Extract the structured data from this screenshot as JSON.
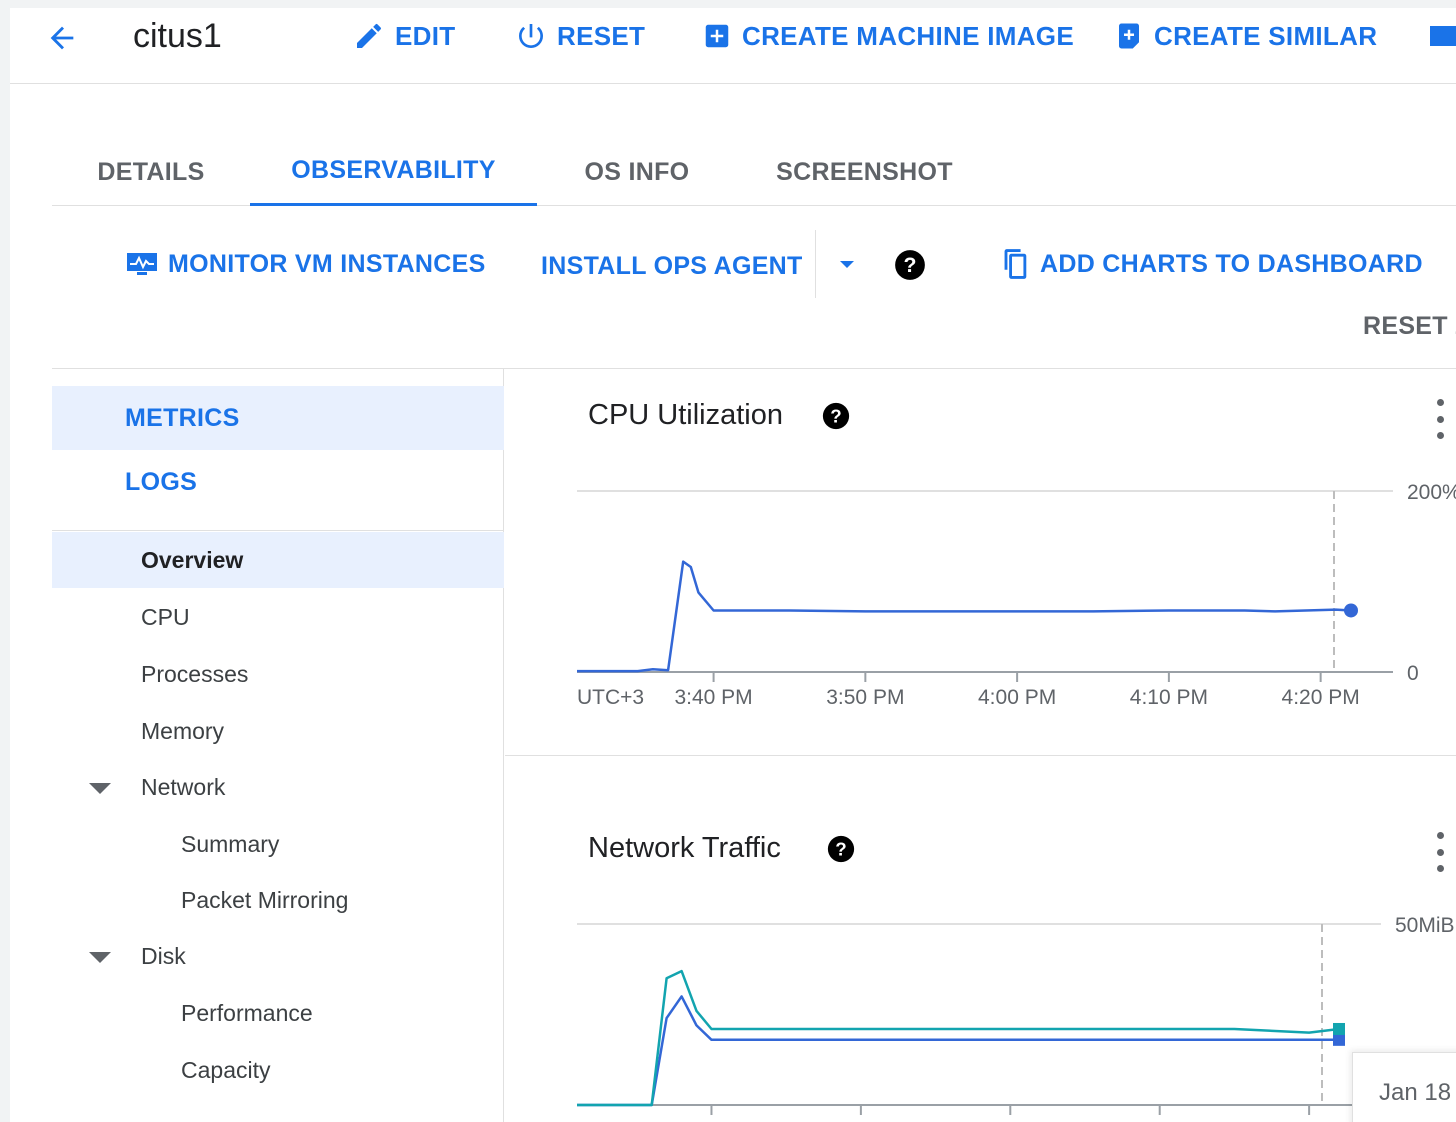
{
  "header": {
    "title": "citus1",
    "actions": {
      "edit": "EDIT",
      "reset": "RESET",
      "create_machine_image": "CREATE MACHINE IMAGE",
      "create_similar": "CREATE SIMILAR"
    }
  },
  "tabs": [
    {
      "label": "DETAILS"
    },
    {
      "label": "OBSERVABILITY"
    },
    {
      "label": "OS INFO"
    },
    {
      "label": "SCREENSHOT"
    }
  ],
  "toolbar": {
    "monitor": "MONITOR VM INSTANCES",
    "install_agent": "INSTALL OPS AGENT",
    "add_charts": "ADD CHARTS TO DASHBOARD",
    "reset_zoom": "RESET Z"
  },
  "leftnav": {
    "metrics": "METRICS",
    "logs": "LOGS",
    "items": [
      {
        "label": "Overview"
      },
      {
        "label": "CPU"
      },
      {
        "label": "Processes"
      },
      {
        "label": "Memory"
      },
      {
        "label": "Network"
      },
      {
        "label": "Summary"
      },
      {
        "label": "Packet Mirroring"
      },
      {
        "label": "Disk"
      },
      {
        "label": "Performance"
      },
      {
        "label": "Capacity"
      }
    ]
  },
  "colors": {
    "accent": "#1a73e8",
    "series_primary": "#3367d6",
    "series_secondary": "#12a4af"
  },
  "date_chip": "Jan 18",
  "chart_data": [
    {
      "type": "line",
      "title": "CPU Utilization",
      "timezone_label": "UTC+3",
      "x_ticks": [
        "3:40 PM",
        "3:50 PM",
        "4:00 PM",
        "4:10 PM",
        "4:20 PM"
      ],
      "y_ticks": [
        "200%",
        "0"
      ],
      "ylim": [
        0,
        200
      ],
      "xlim": [
        "3:31 PM",
        "4:22 PM"
      ],
      "grid": true,
      "series": [
        {
          "x": [
            "3:31",
            "3:35",
            "3:36",
            "3:37",
            "3:38",
            "3:38.5",
            "3:39",
            "3:40",
            "3:45",
            "3:50",
            "3:55",
            "4:00",
            "4:05",
            "4:10",
            "4:15",
            "4:17",
            "4:19",
            "4:21",
            "4:22"
          ],
          "values": [
            1,
            1,
            3,
            2,
            122,
            116,
            88,
            68,
            68,
            67,
            67,
            67,
            67,
            68,
            68,
            67,
            68,
            69,
            68
          ]
        }
      ]
    },
    {
      "type": "line",
      "title": "Network Traffic",
      "timezone_label": "UTC+3",
      "x_ticks": [
        "3:40 PM",
        "3:50 PM",
        "4:00 PM",
        "4:10 PM",
        "4:20 PM"
      ],
      "y_ticks": [
        "50MiB"
      ],
      "ylim": [
        0,
        50
      ],
      "xlim": [
        "3:31 PM",
        "4:22 PM"
      ],
      "grid": true,
      "series": [
        {
          "x": [
            "3:31",
            "3:36",
            "3:37",
            "3:38",
            "3:39",
            "3:40",
            "3:45",
            "3:50",
            "3:55",
            "4:00",
            "4:05",
            "4:10",
            "4:15",
            "4:20",
            "4:22"
          ],
          "values": [
            0,
            0,
            24,
            30,
            22,
            18,
            18,
            18,
            18,
            18,
            18,
            18,
            18,
            18,
            18
          ]
        },
        {
          "x": [
            "3:31",
            "3:36",
            "3:37",
            "3:38",
            "3:39",
            "3:40",
            "3:45",
            "3:50",
            "3:55",
            "4:00",
            "4:05",
            "4:10",
            "4:15",
            "4:20",
            "4:22"
          ],
          "values": [
            0,
            0,
            35,
            37,
            26,
            21,
            21,
            21,
            21,
            21,
            21,
            21,
            21,
            20,
            21
          ]
        }
      ]
    }
  ]
}
